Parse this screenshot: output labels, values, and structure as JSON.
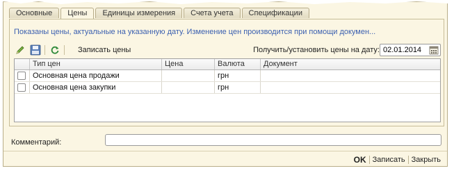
{
  "tabs": [
    {
      "label": "Основные"
    },
    {
      "label": "Цены"
    },
    {
      "label": "Единицы измерения"
    },
    {
      "label": "Счета учета"
    },
    {
      "label": "Спецификации"
    }
  ],
  "info_text": "Показаны цены, актуальные на указанную дату. Изменение цен производится при помощи докумен...",
  "toolbar": {
    "edit_icon": "pencil-icon",
    "save_icon": "save-disk-icon",
    "refresh_icon": "refresh-icon",
    "write_prices_label": "Записать цены",
    "date_label": "Получить/установить цены на дату:",
    "date_value": "02.01.2014"
  },
  "grid": {
    "columns": [
      "Тип цен",
      "Цена",
      "Валюта",
      "Документ"
    ],
    "rows": [
      {
        "type": "Основная цена продажи",
        "price": "",
        "currency": "грн",
        "document": ""
      },
      {
        "type": "Основная цена закупки",
        "price": "",
        "currency": "грн",
        "document": ""
      }
    ]
  },
  "comment": {
    "label": "Комментарий:",
    "value": ""
  },
  "footer": {
    "ok": "OK",
    "save": "Записать",
    "close": "Закрыть"
  },
  "colors": {
    "info_text": "#3a5fb0",
    "window_bg": "#fbf6e3",
    "border": "#b8ad88"
  }
}
